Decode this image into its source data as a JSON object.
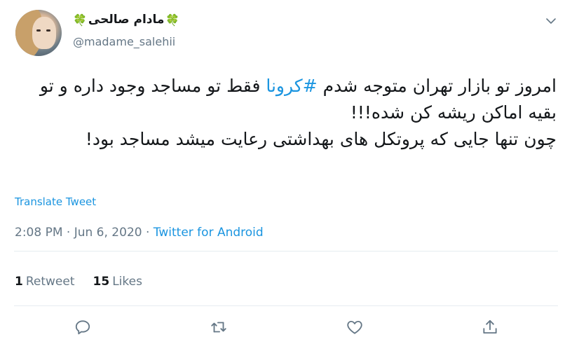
{
  "user": {
    "display_name": "مادام صالحی",
    "clover_left": "🍀",
    "clover_right": "🍀",
    "handle": "@madame_salehii"
  },
  "tweet": {
    "line1_prefix": "امروز تو بازار تهران متوجه شدم ",
    "hashtag": "#کرونا",
    "line1_suffix": " فقط تو مساجد وجود داره و تو بقیه اماکن ریشه کن شده!!!",
    "line2": "چون تنها جایی که پروتکل های بهداشتی رعایت میشد مساجد بود!"
  },
  "translate_label": "Translate Tweet",
  "meta": {
    "time": "2:08 PM",
    "sep1": " · ",
    "date": "Jun 6, 2020",
    "sep2": " · ",
    "source": "Twitter for Android"
  },
  "stats": {
    "retweets_count": "1",
    "retweets_label": "Retweet",
    "likes_count": "15",
    "likes_label": "Likes"
  },
  "actions": {
    "icons": [
      "reply-icon",
      "retweet-icon",
      "like-icon",
      "share-icon"
    ]
  },
  "colors": {
    "link": "#1b95e0",
    "secondary": "#657786",
    "text": "#14171a",
    "divider": "#e6ecf0"
  }
}
